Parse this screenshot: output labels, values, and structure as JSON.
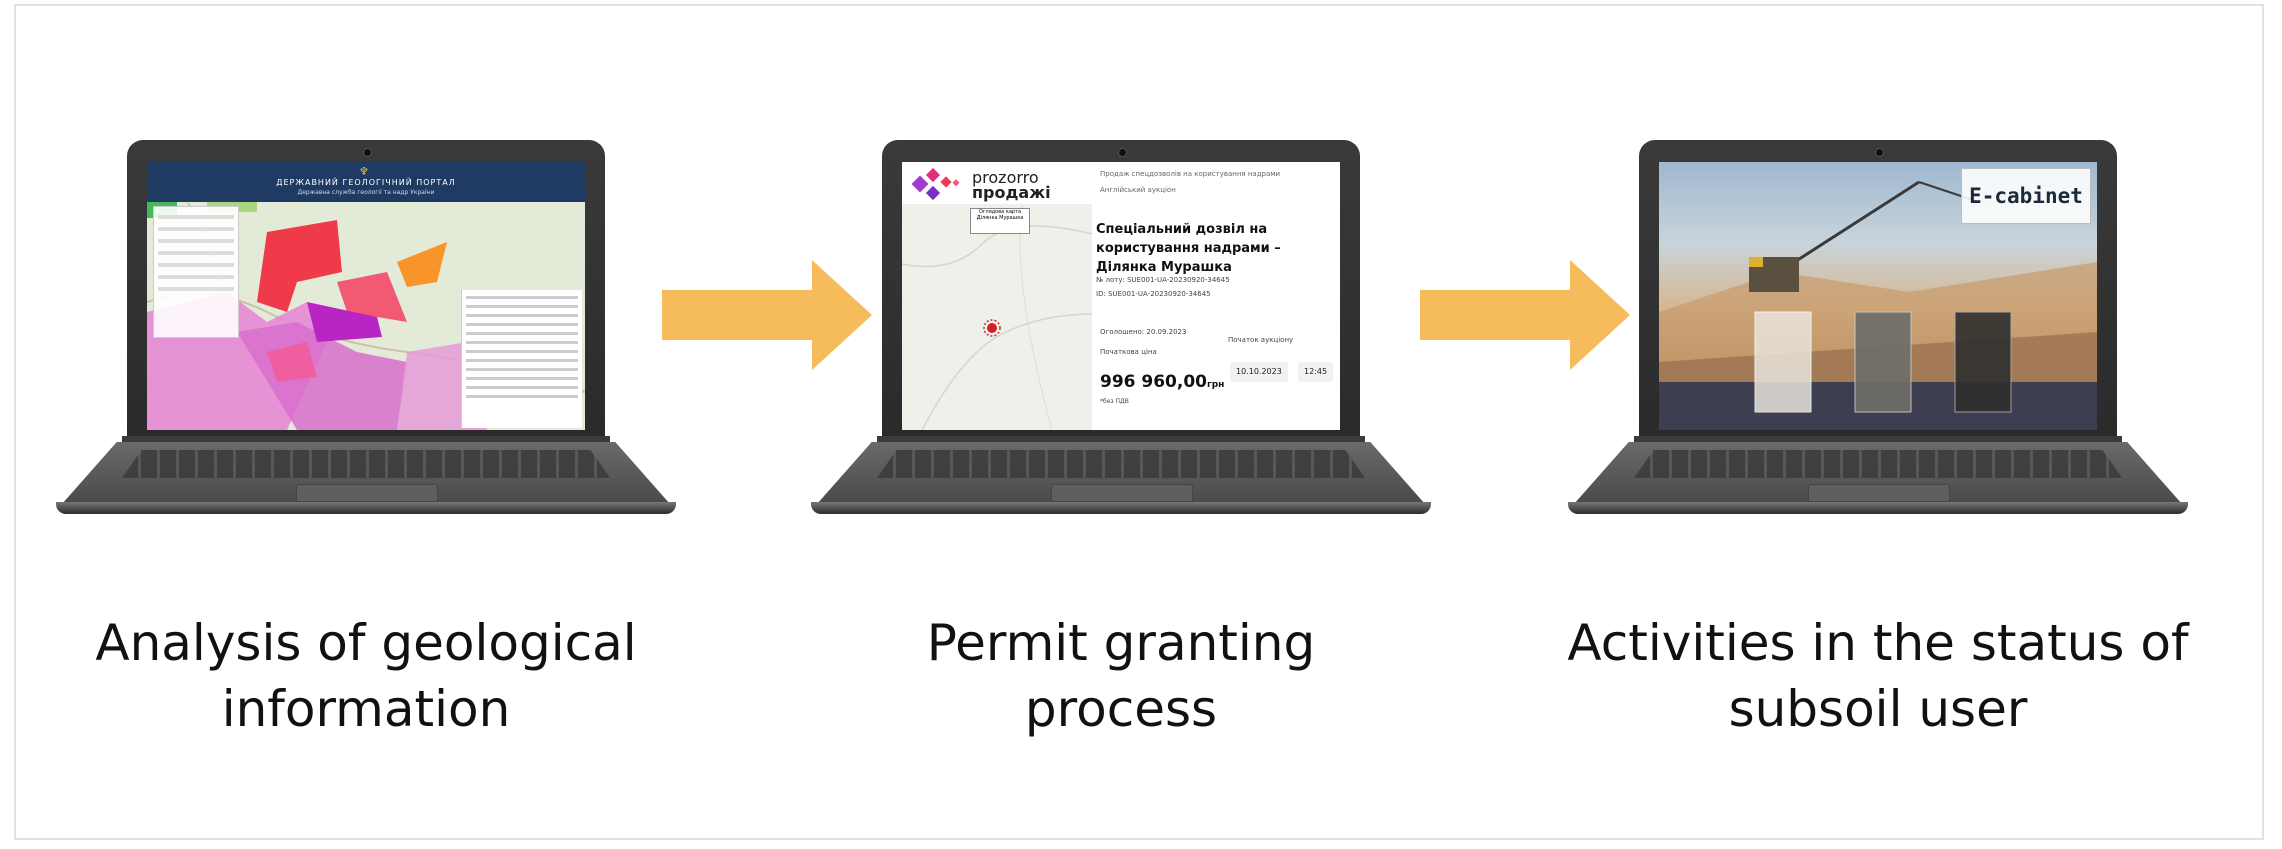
{
  "steps": [
    {
      "caption_line1": "Analysis of geological",
      "caption_line2": "information"
    },
    {
      "caption_line1": "Permit granting",
      "caption_line2": "process"
    },
    {
      "caption_line1": "Activities in the status of",
      "caption_line2": "subsoil user"
    }
  ],
  "screen1": {
    "title": "ДЕРЖАВНИЙ ГЕОЛОГІЧНИЙ ПОРТАЛ",
    "subtitle": "Державна служба геології та надр України"
  },
  "screen2": {
    "logo_top": "prozorro",
    "logo_bottom": "продажі",
    "top_line1": "Продаж спецдозволів на користування надрами",
    "top_line2": "Англійський аукціон",
    "map_label": "Оглядова карта Ділянка Мурашка",
    "title": "Спеціальний дозвіл на користування надрами – Ділянка Мурашка",
    "lot": "№ лоту: SUE001-UA-20230920-34645",
    "id": "ID: SUE001-UA-20230920-34645",
    "announced": "Оголошено: 20.09.2023",
    "start_price_label": "Початкова ціна",
    "price": "996 960,00",
    "currency": "грн",
    "vat_note": "*без ПДВ",
    "auction_start_label": "Початок аукціону",
    "auction_date": "10.10.2023",
    "auction_time": "12:45"
  },
  "screen3": {
    "badge": "E-cabinet"
  },
  "colors": {
    "arrow": "#f6bb5a",
    "laptop": "#2e2e2e",
    "caption": "#111111"
  }
}
